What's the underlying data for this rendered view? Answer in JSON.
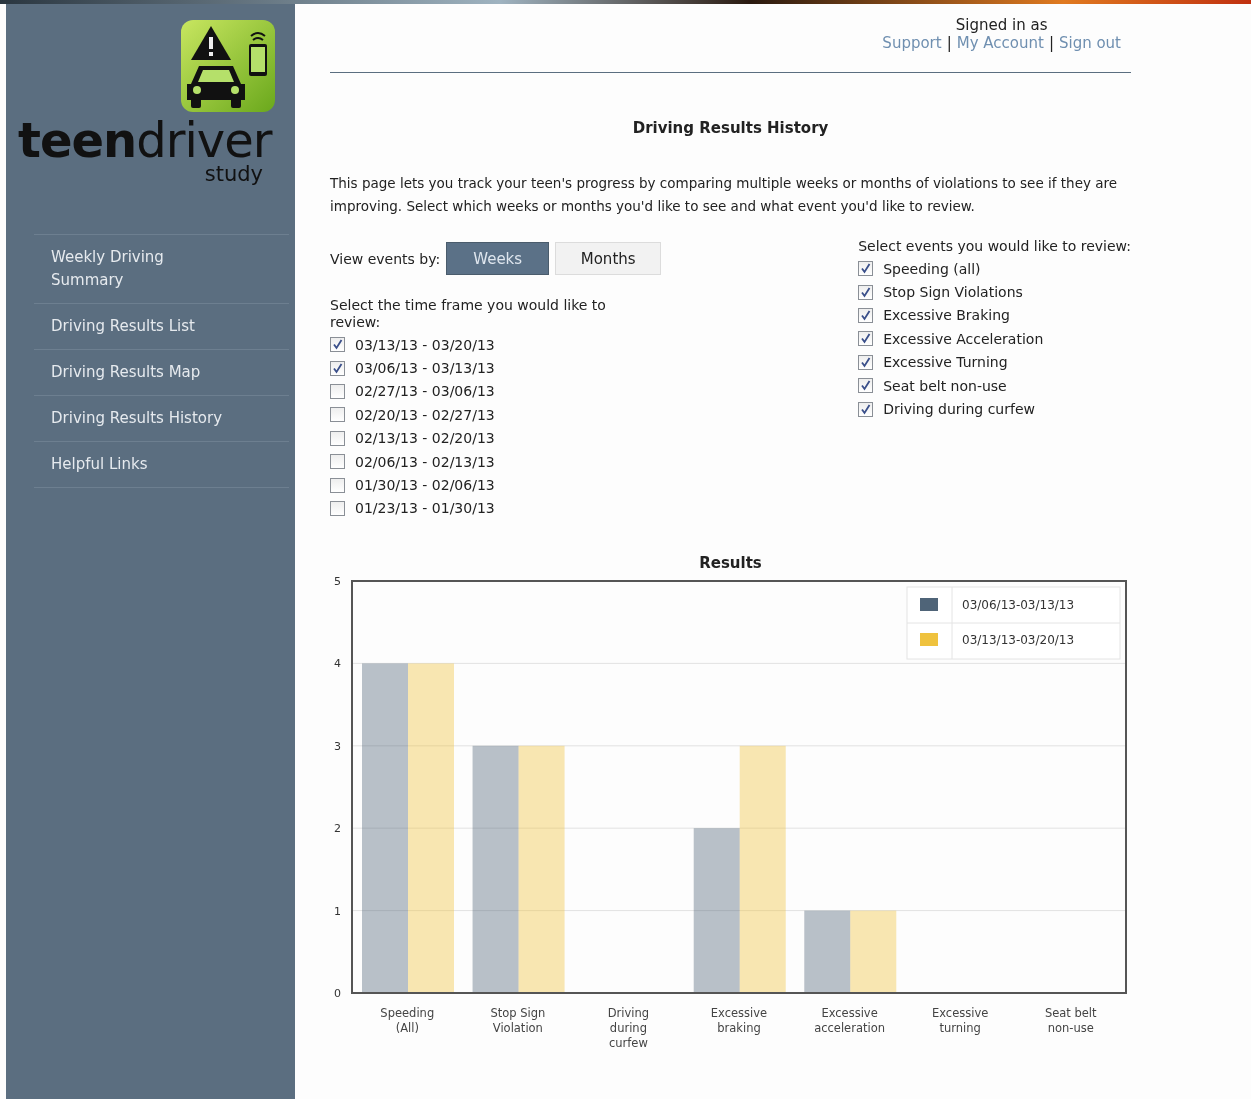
{
  "brand": {
    "name": "**teen**driver",
    "tagline": "study"
  },
  "sidebar": {
    "items": [
      {
        "label": "Weekly Driving Summary"
      },
      {
        "label": "Driving Results List"
      },
      {
        "label": "Driving Results Map"
      },
      {
        "label": "Driving Results History"
      },
      {
        "label": "Helpful Links"
      }
    ]
  },
  "header": {
    "signed_in": "Signed in as",
    "links": [
      {
        "label": "Support"
      },
      {
        "label": "My Account"
      },
      {
        "label": "Sign out"
      }
    ],
    "separator": "|"
  },
  "page": {
    "title": "Driving Results History",
    "intro": "This page lets you track your teen's progress by comparing multiple weeks or months of violations to see if they are improving. Select which weeks or months you'd like to see and what event you'd like to review."
  },
  "view_by": {
    "label": "View events by:",
    "options": [
      {
        "label": "Weeks",
        "selected": true
      },
      {
        "label": "Months",
        "selected": false
      }
    ]
  },
  "time_frames": {
    "label": "Select the time frame you would like to review:",
    "items": [
      {
        "label": "03/13/13 - 03/20/13",
        "checked": true
      },
      {
        "label": "03/06/13 - 03/13/13",
        "checked": true
      },
      {
        "label": "02/27/13 - 03/06/13",
        "checked": false
      },
      {
        "label": "02/20/13 - 02/27/13",
        "checked": false
      },
      {
        "label": "02/13/13 - 02/20/13",
        "checked": false
      },
      {
        "label": "02/06/13 - 02/13/13",
        "checked": false
      },
      {
        "label": "01/30/13 - 02/06/13",
        "checked": false
      },
      {
        "label": "01/23/13 - 01/30/13",
        "checked": false
      }
    ]
  },
  "events": {
    "label": "Select events you would like to review:",
    "items": [
      {
        "label": "Speeding (all)",
        "checked": true
      },
      {
        "label": "Stop Sign Violations",
        "checked": true
      },
      {
        "label": "Excessive Braking",
        "checked": true
      },
      {
        "label": "Excessive Acceleration",
        "checked": true
      },
      {
        "label": "Excessive Turning",
        "checked": true
      },
      {
        "label": "Seat belt non-use",
        "checked": true
      },
      {
        "label": "Driving during curfew",
        "checked": true
      }
    ]
  },
  "results": {
    "chart_data": {
      "type": "bar",
      "title": "Results",
      "categories": [
        "Speeding (All)",
        "Stop Sign Violation",
        "Driving during curfew",
        "Excessive braking",
        "Excessive acceleration",
        "Excessive turning",
        "Seat belt non-use"
      ],
      "series": [
        {
          "name": "03/06/13-03/13/13",
          "color": "#4f6478",
          "values": [
            4,
            3,
            0,
            2,
            1,
            0,
            0
          ]
        },
        {
          "name": "03/13/13-03/20/13",
          "color": "#efc23e",
          "values": [
            4,
            3,
            0,
            3,
            1,
            0,
            0
          ]
        }
      ],
      "ylim": [
        0,
        5
      ],
      "yticks": [
        0,
        1,
        2,
        3,
        4,
        5
      ],
      "grid": true,
      "legend": true
    }
  }
}
